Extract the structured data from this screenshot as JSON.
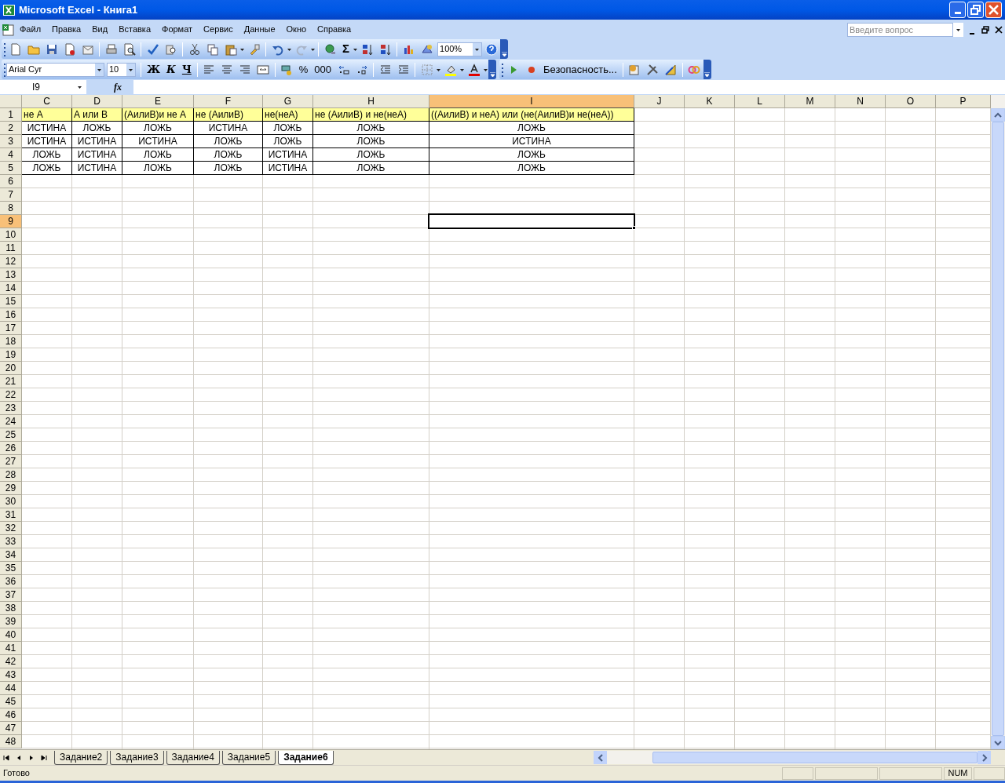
{
  "window": {
    "title": "Microsoft Excel - Книга1"
  },
  "menu": [
    "Файл",
    "Правка",
    "Вид",
    "Вставка",
    "Формат",
    "Сервис",
    "Данные",
    "Окно",
    "Справка"
  ],
  "help_search": {
    "placeholder": "Введите вопрос"
  },
  "standard_toolbar": {
    "autosum": "Σ",
    "zoom": "100%"
  },
  "formatting_toolbar": {
    "font": "Arial Cyr",
    "size": "10",
    "bold": "Ж",
    "italic": "К",
    "underline": "Ч",
    "percent": "%",
    "thousands": "000"
  },
  "macro_toolbar": {
    "security_button": "Безопасность..."
  },
  "formula_bar": {
    "name_box": "I9",
    "function_label": "fx"
  },
  "columns": [
    {
      "label": "C",
      "selected": false
    },
    {
      "label": "D",
      "selected": false
    },
    {
      "label": "E",
      "selected": false
    },
    {
      "label": "F",
      "selected": false
    },
    {
      "label": "G",
      "selected": false
    },
    {
      "label": "H",
      "selected": false
    },
    {
      "label": "I",
      "selected": true
    },
    {
      "label": "J",
      "selected": false
    },
    {
      "label": "K",
      "selected": false
    },
    {
      "label": "L",
      "selected": false
    },
    {
      "label": "M",
      "selected": false
    },
    {
      "label": "N",
      "selected": false
    },
    {
      "label": "O",
      "selected": false
    },
    {
      "label": "P",
      "selected": false
    }
  ],
  "rows": [
    {
      "label": "1",
      "selected": false,
      "kind": "header",
      "cells": [
        "не А",
        "А или В",
        "(АилиВ)и не А",
        "не (АилиВ)",
        "не(неА)",
        "не (АилиВ) и не(неА)",
        "((АилиВ) и неА) или (не(АилиВ)и не(неА))"
      ]
    },
    {
      "label": "2",
      "selected": false,
      "kind": "data",
      "cells": [
        "ИСТИНА",
        "ЛОЖЬ",
        "ЛОЖЬ",
        "ИСТИНА",
        "ЛОЖЬ",
        "ЛОЖЬ",
        "ЛОЖЬ"
      ]
    },
    {
      "label": "3",
      "selected": false,
      "kind": "data",
      "cells": [
        "ИСТИНА",
        "ИСТИНА",
        "ИСТИНА",
        "ЛОЖЬ",
        "ЛОЖЬ",
        "ЛОЖЬ",
        "ИСТИНА"
      ]
    },
    {
      "label": "4",
      "selected": false,
      "kind": "data",
      "cells": [
        "ЛОЖЬ",
        "ИСТИНА",
        "ЛОЖЬ",
        "ЛОЖЬ",
        "ИСТИНА",
        "ЛОЖЬ",
        "ЛОЖЬ"
      ]
    },
    {
      "label": "5",
      "selected": false,
      "kind": "data",
      "cells": [
        "ЛОЖЬ",
        "ИСТИНА",
        "ЛОЖЬ",
        "ЛОЖЬ",
        "ИСТИНА",
        "ЛОЖЬ",
        "ЛОЖЬ"
      ]
    },
    {
      "label": "6",
      "selected": false
    },
    {
      "label": "7",
      "selected": false
    },
    {
      "label": "8",
      "selected": false
    },
    {
      "label": "9",
      "selected": true
    },
    {
      "label": "10",
      "selected": false
    },
    {
      "label": "11",
      "selected": false
    },
    {
      "label": "12",
      "selected": false
    },
    {
      "label": "13",
      "selected": false
    },
    {
      "label": "14",
      "selected": false
    },
    {
      "label": "15",
      "selected": false
    },
    {
      "label": "16",
      "selected": false
    },
    {
      "label": "17",
      "selected": false
    },
    {
      "label": "18",
      "selected": false
    },
    {
      "label": "19",
      "selected": false
    },
    {
      "label": "20",
      "selected": false
    },
    {
      "label": "21",
      "selected": false
    },
    {
      "label": "22",
      "selected": false
    },
    {
      "label": "23",
      "selected": false
    },
    {
      "label": "24",
      "selected": false
    },
    {
      "label": "25",
      "selected": false
    },
    {
      "label": "26",
      "selected": false
    },
    {
      "label": "27",
      "selected": false
    },
    {
      "label": "28",
      "selected": false
    },
    {
      "label": "29",
      "selected": false
    },
    {
      "label": "30",
      "selected": false
    },
    {
      "label": "31",
      "selected": false
    },
    {
      "label": "32",
      "selected": false
    },
    {
      "label": "33",
      "selected": false
    },
    {
      "label": "34",
      "selected": false
    },
    {
      "label": "35",
      "selected": false
    },
    {
      "label": "36",
      "selected": false
    },
    {
      "label": "37",
      "selected": false
    },
    {
      "label": "38",
      "selected": false
    },
    {
      "label": "39",
      "selected": false
    },
    {
      "label": "40",
      "selected": false
    },
    {
      "label": "41",
      "selected": false
    },
    {
      "label": "42",
      "selected": false
    },
    {
      "label": "43",
      "selected": false
    },
    {
      "label": "44",
      "selected": false
    },
    {
      "label": "45",
      "selected": false
    },
    {
      "label": "46",
      "selected": false
    },
    {
      "label": "47",
      "selected": false
    },
    {
      "label": "48",
      "selected": false
    }
  ],
  "sheet_tabs": [
    {
      "label": "Задание2",
      "selected": false
    },
    {
      "label": "Задание3",
      "selected": false
    },
    {
      "label": "Задание4",
      "selected": false
    },
    {
      "label": "Задание5",
      "selected": false
    },
    {
      "label": "Задание6",
      "selected": true
    }
  ],
  "status_bar": {
    "text": "Готово",
    "indicator": "NUM"
  }
}
